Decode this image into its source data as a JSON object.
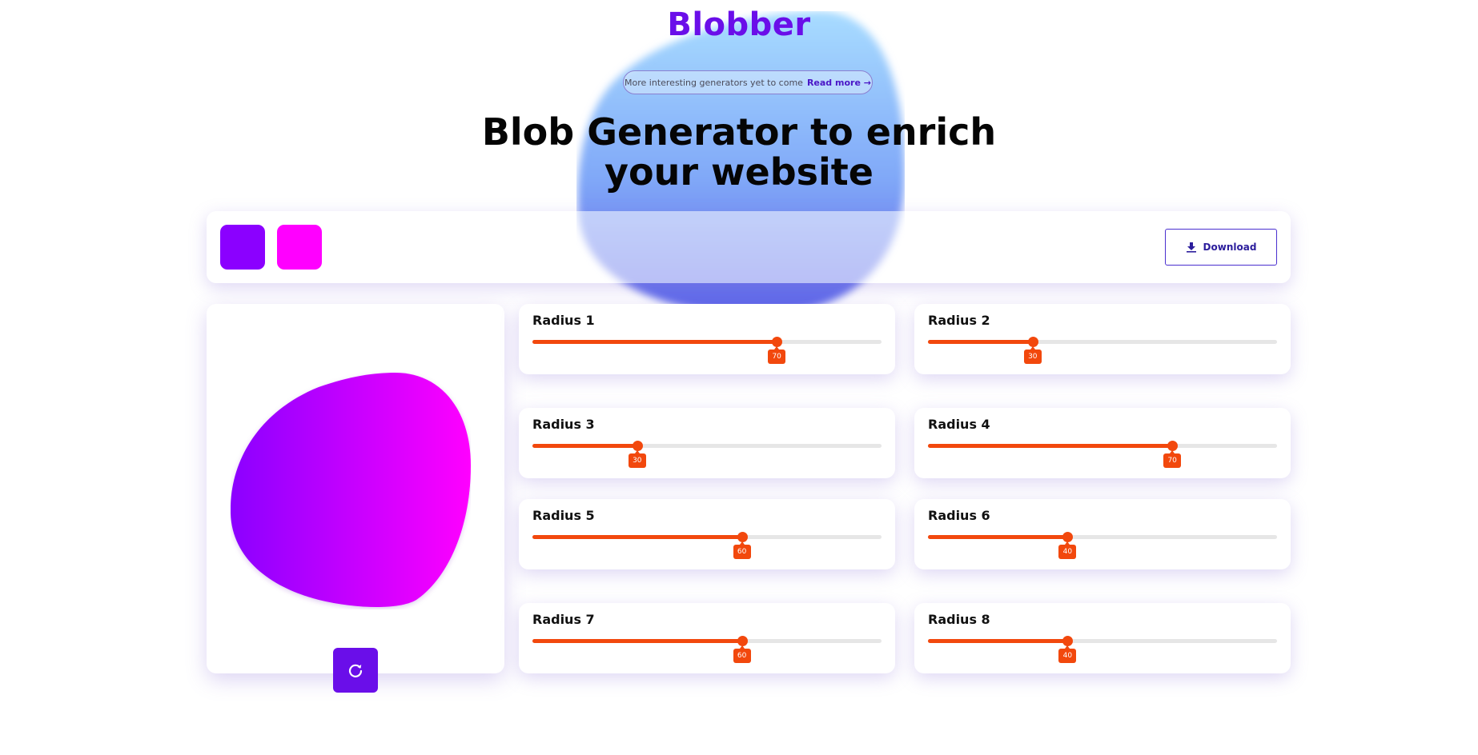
{
  "brand": "Blobber",
  "announcement": {
    "text": "More interesting generators yet to come",
    "link": "Read more →"
  },
  "headline": {
    "line1": "Blob Generator to enrich",
    "line2": "your website"
  },
  "colors": {
    "start": "#8b00ff",
    "end": "#ff00ff",
    "accent": "#6a0ee9",
    "slider": "#f2480d"
  },
  "toolbar": {
    "download_label": "Download",
    "download_icon": "download-icon",
    "start_color_swatch": "color-swatch-start",
    "end_color_swatch": "color-swatch-end"
  },
  "preview": {
    "refresh_icon": "refresh-icon"
  },
  "sliders": [
    {
      "label": "Radius 1",
      "value": 70
    },
    {
      "label": "Radius 2",
      "value": 30
    },
    {
      "label": "Radius 3",
      "value": 30
    },
    {
      "label": "Radius 4",
      "value": 70
    },
    {
      "label": "Radius 5",
      "value": 60
    },
    {
      "label": "Radius 6",
      "value": 40
    },
    {
      "label": "Radius 7",
      "value": 60
    },
    {
      "label": "Radius 8",
      "value": 40
    }
  ]
}
